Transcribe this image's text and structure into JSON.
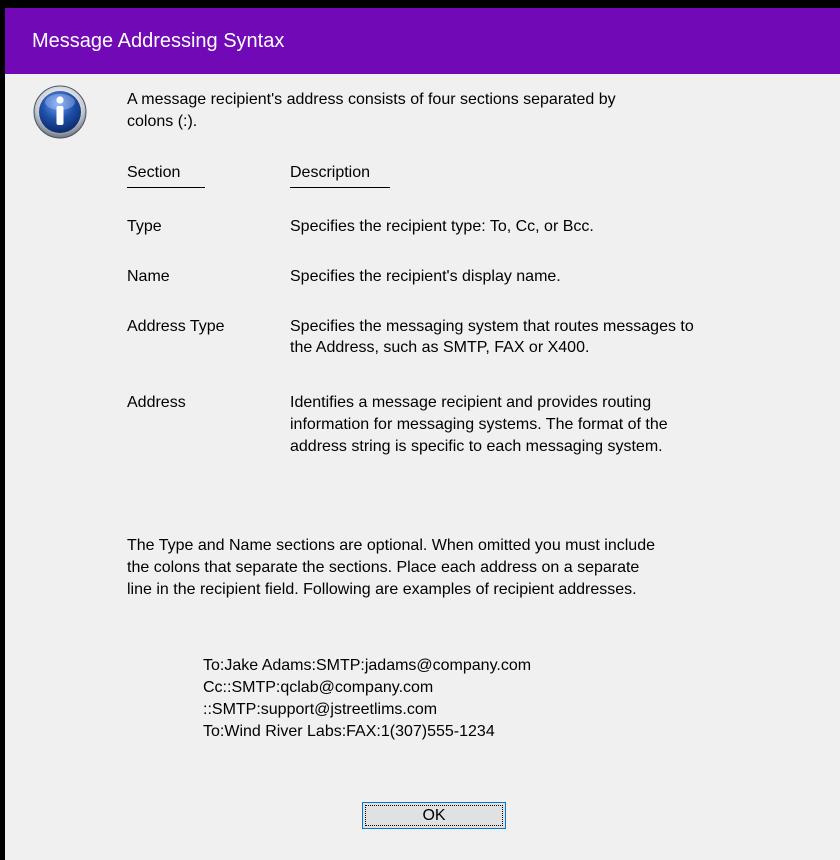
{
  "window": {
    "title": "Message Addressing Syntax"
  },
  "dialog": {
    "icon": "info-icon",
    "intro_line1": "A message recipient's address consists of four sections separated by",
    "intro_line2": "colons (:).",
    "table": {
      "headers": [
        "Section",
        "Description"
      ],
      "rows": [
        {
          "section": "Type",
          "description": [
            "Specifies the recipient type: To, Cc, or Bcc."
          ]
        },
        {
          "section": "Name",
          "description": [
            "Specifies the recipient's display name."
          ]
        },
        {
          "section": "Address Type",
          "description": [
            "Specifies the messaging system that routes messages to",
            "the Address, such as SMTP, FAX or X400."
          ]
        },
        {
          "section": "Address",
          "description": [
            "Identifies a message recipient and provides routing",
            "information for messaging systems.  The format of the",
            "address string is specific to each messaging system."
          ]
        }
      ]
    },
    "note_lines": [
      "The Type and Name sections are optional.  When omitted you must include",
      "the colons that separate the sections.  Place each address on a separate",
      "line in the recipient field.  Following are examples of recipient addresses."
    ],
    "examples": [
      "To:Jake Adams:SMTP:jadams@company.com",
      "Cc::SMTP:qclab@company.com",
      "::SMTP:support@jstreetlims.com",
      "To:Wind River Labs:FAX:1(307)555-1234"
    ],
    "ok_label": "OK"
  },
  "colors": {
    "titlebar": "#7209b7",
    "title_text": "#ffffff",
    "client_bg": "#f0f0f0",
    "button_bg": "#e1e1e1",
    "button_border": "#0078d7",
    "icon_blue": "#1f4fa8"
  }
}
